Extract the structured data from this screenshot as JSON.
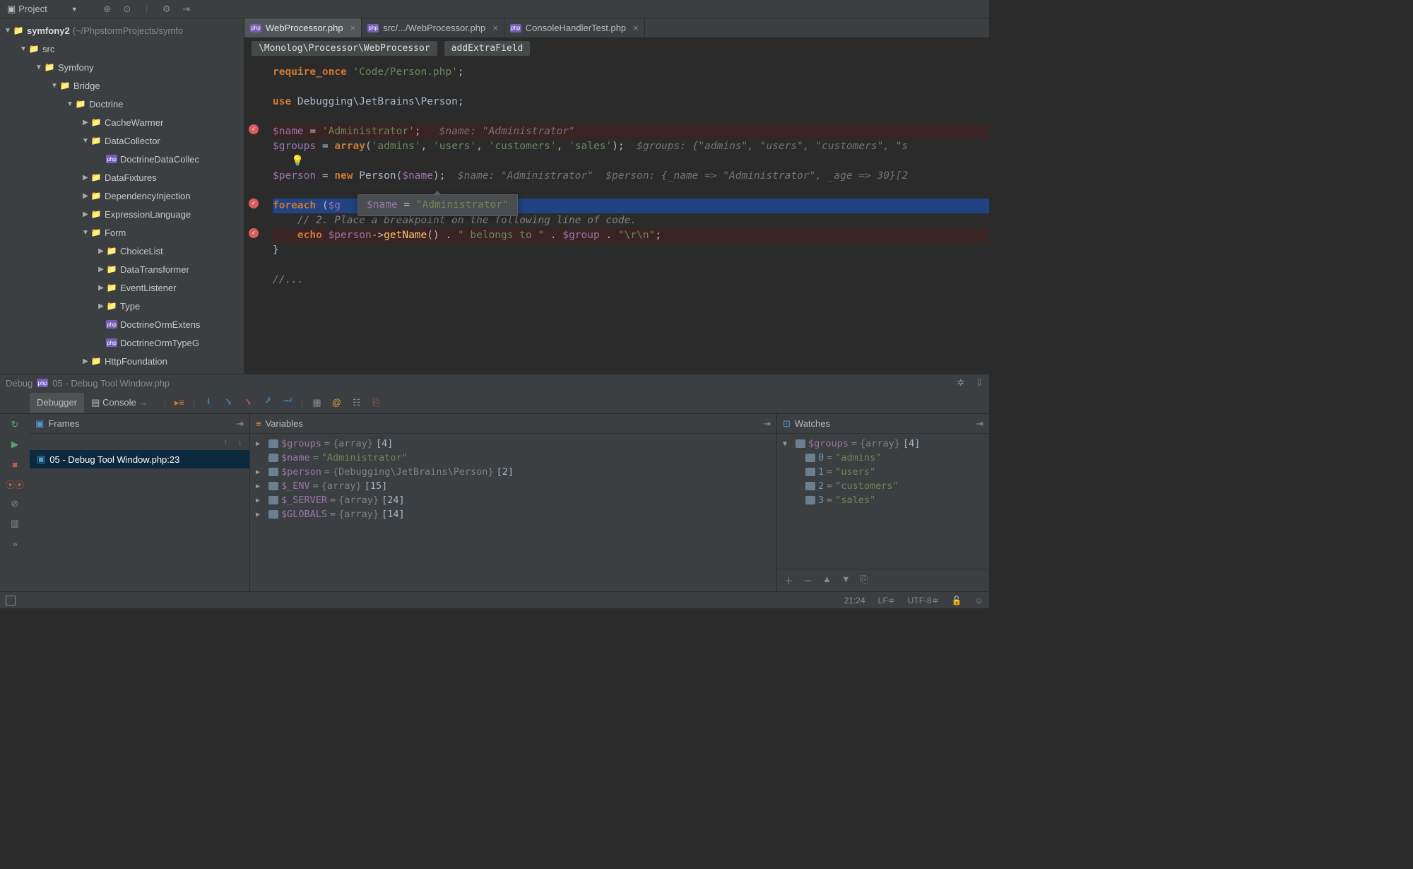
{
  "toolbar": {
    "project_label": "Project"
  },
  "project_tree": {
    "root_name": "symfony2",
    "root_path": "(~/PhpstormProjects/symfo",
    "items": [
      {
        "depth": 1,
        "tw": "▼",
        "icon": "folder",
        "label": "src"
      },
      {
        "depth": 2,
        "tw": "▼",
        "icon": "folder",
        "label": "Symfony"
      },
      {
        "depth": 3,
        "tw": "▼",
        "icon": "folder",
        "label": "Bridge"
      },
      {
        "depth": 4,
        "tw": "▼",
        "icon": "folder",
        "label": "Doctrine"
      },
      {
        "depth": 5,
        "tw": "▶",
        "icon": "folder",
        "label": "CacheWarmer"
      },
      {
        "depth": 5,
        "tw": "▼",
        "icon": "folder",
        "label": "DataCollector"
      },
      {
        "depth": 6,
        "tw": "",
        "icon": "php",
        "label": "DoctrineDataCollec"
      },
      {
        "depth": 5,
        "tw": "▶",
        "icon": "folder",
        "label": "DataFixtures"
      },
      {
        "depth": 5,
        "tw": "▶",
        "icon": "folder",
        "label": "DependencyInjection"
      },
      {
        "depth": 5,
        "tw": "▶",
        "icon": "folder",
        "label": "ExpressionLanguage"
      },
      {
        "depth": 5,
        "tw": "▼",
        "icon": "folder",
        "label": "Form"
      },
      {
        "depth": 6,
        "tw": "▶",
        "icon": "folder",
        "label": "ChoiceList"
      },
      {
        "depth": 6,
        "tw": "▶",
        "icon": "folder",
        "label": "DataTransformer"
      },
      {
        "depth": 6,
        "tw": "▶",
        "icon": "folder",
        "label": "EventListener"
      },
      {
        "depth": 6,
        "tw": "▶",
        "icon": "folder",
        "label": "Type"
      },
      {
        "depth": 6,
        "tw": "",
        "icon": "php",
        "label": "DoctrineOrmExtens"
      },
      {
        "depth": 6,
        "tw": "",
        "icon": "php",
        "label": "DoctrineOrmTypeG"
      },
      {
        "depth": 5,
        "tw": "▶",
        "icon": "folder",
        "label": "HttpFoundation"
      }
    ]
  },
  "tabs": [
    {
      "icon": "php",
      "label": "WebProcessor.php",
      "active": true
    },
    {
      "icon": "php",
      "label": "src/.../WebProcessor.php",
      "active": false
    },
    {
      "icon": "php",
      "label": "ConsoleHandlerTest.php",
      "active": false
    }
  ],
  "breadcrumb": {
    "seg1": "\\Monolog\\Processor\\WebProcessor",
    "seg2": "addExtraField"
  },
  "code": {
    "l1a": "require_once",
    "l1b": " 'Code/Person.php'",
    "l1c": ";",
    "l2a": "use ",
    "l2b": "Debugging\\JetBrains\\Person;",
    "l3a": "$name",
    "l3b": " = ",
    "l3c": "'Administrator'",
    "l3d": ";   ",
    "l3hint": "$name: \"Administrator\"",
    "l4a": "$groups",
    "l4b": " = ",
    "l4c": "array",
    "l4d": "(",
    "l4e": "'admins'",
    "l4f": ", ",
    "l4g": "'users'",
    "l4h": ", ",
    "l4i": "'customers'",
    "l4j": ", ",
    "l4k": "'sales'",
    "l4l": ");  ",
    "l4hint": "$groups: {\"admins\", \"users\", \"customers\", \"s",
    "bulb": "💡",
    "l5a": "$person",
    "l5b": " = ",
    "l5c": "new ",
    "l5d": "Person(",
    "l5e": "$name",
    "l5f": ");  ",
    "l5hint": "$name: \"Administrator\"  $person: {_name => \"Administrator\", _age => 30}[2",
    "l6a": "foreach ",
    "l6b": "(",
    "l6c": "$g",
    "tooltip_var": "$name",
    "tooltip_eq": " = ",
    "tooltip_val": "\"Administrator\"",
    "l7cmt": "// 2. Place a breakpoint on the following line of code.",
    "l8a": "echo ",
    "l8b": "$person",
    "l8c": "->",
    "l8d": "getName",
    "l8e": "() . ",
    "l8f": "\" belongs to \"",
    "l8g": " . ",
    "l8h": "$group",
    "l8i": " . ",
    "l8j": "\"\\r\\n\"",
    "l8k": ";",
    "l9": "}",
    "l10": "//..."
  },
  "debug": {
    "title_prefix": "Debug",
    "title_file": "05 - Debug Tool Window.php",
    "tab_debugger": "Debugger",
    "tab_console": "Console",
    "frames_label": "Frames",
    "variables_label": "Variables",
    "watches_label": "Watches",
    "frame_item": "05 - Debug Tool Window.php:23",
    "variables": [
      {
        "tw": "▶",
        "name": "$groups",
        "type": "{array}",
        "extra": "[4]"
      },
      {
        "tw": "",
        "name": "$name",
        "val": "\"Administrator\""
      },
      {
        "tw": "▶",
        "name": "$person",
        "type": "{Debugging\\JetBrains\\Person}",
        "extra": "[2]"
      },
      {
        "tw": "▶",
        "name": "$_ENV",
        "type": "{array}",
        "extra": "[15]"
      },
      {
        "tw": "▶",
        "name": "$_SERVER",
        "type": "{array}",
        "extra": "[24]"
      },
      {
        "tw": "▶",
        "name": "$GLOBALS",
        "type": "{array}",
        "extra": "[14]"
      }
    ],
    "watches": {
      "root": {
        "name": "$groups",
        "type": "{array}",
        "extra": "[4]"
      },
      "items": [
        {
          "idx": "0",
          "val": "\"admins\""
        },
        {
          "idx": "1",
          "val": "\"users\""
        },
        {
          "idx": "2",
          "val": "\"customers\""
        },
        {
          "idx": "3",
          "val": "\"sales\""
        }
      ]
    }
  },
  "status": {
    "pos": "21:24",
    "le": "LF≑",
    "enc": "UTF-8≑"
  }
}
